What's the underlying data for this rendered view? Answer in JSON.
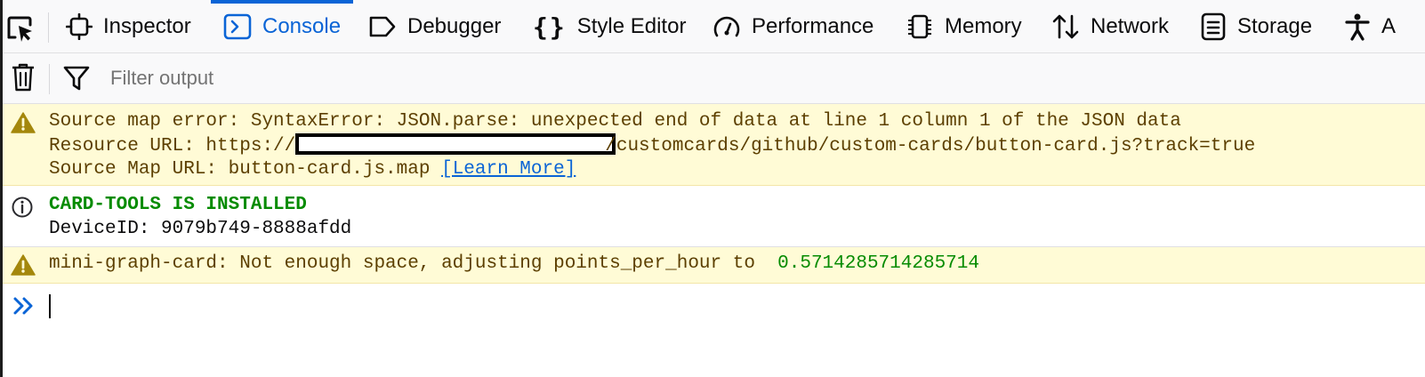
{
  "toolbar": {
    "tabs": [
      {
        "label": "Inspector"
      },
      {
        "label": "Console"
      },
      {
        "label": "Debugger"
      },
      {
        "label": "Style Editor"
      },
      {
        "label": "Performance"
      },
      {
        "label": "Memory"
      },
      {
        "label": "Network"
      },
      {
        "label": "Storage"
      },
      {
        "label": "A"
      }
    ],
    "selected_tab": "Console"
  },
  "filter": {
    "placeholder": "Filter output",
    "value": ""
  },
  "messages": [
    {
      "level": "warning",
      "line1": "Source map error: SyntaxError: JSON.parse: unexpected end of data at line 1 column 1 of the JSON data",
      "resource_prefix": "Resource URL: https://",
      "resource_suffix": "/customcards/github/custom-cards/button-card.js?track=true",
      "source_map": "Source Map URL: button-card.js.map",
      "learn_more": "[Learn More]"
    },
    {
      "level": "info",
      "title": "CARD-TOOLS IS INSTALLED",
      "detail": "DeviceID: 9079b749-8888afdd"
    },
    {
      "level": "warning",
      "text": "mini-graph-card: Not enough space, adjusting points_per_hour to ",
      "value": "0.5714285714285714"
    }
  ],
  "colors": {
    "accent": "#0a64d6",
    "warning_bg": "#fffbd6",
    "warning_text": "#5c3f00",
    "warning_icon": "#a4870c",
    "success_green": "#058b00"
  },
  "icons": {
    "picker": "element-picker-icon",
    "trash": "trash-icon",
    "filter": "filter-icon",
    "warning": "warning-icon",
    "info": "info-icon",
    "prompt": "double-chevron-icon"
  }
}
